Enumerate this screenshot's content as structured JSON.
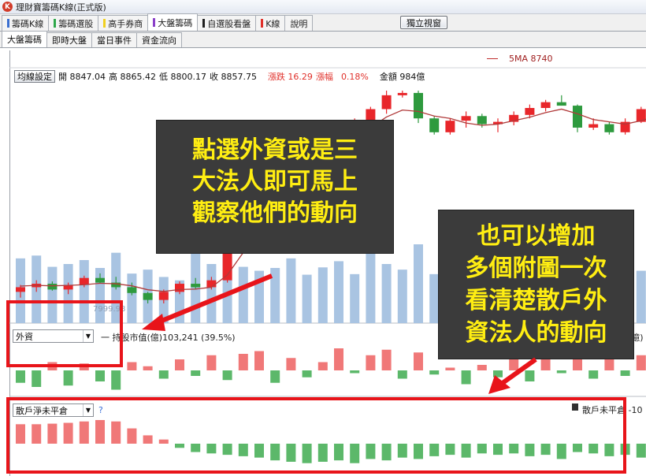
{
  "window": {
    "title": "理財寶籌碼K線(正式版)",
    "icon": "K"
  },
  "main_tabs": [
    {
      "label": "籌碼K線",
      "color": "#3b6fd0"
    },
    {
      "label": "籌碼選股",
      "color": "#2ea84a"
    },
    {
      "label": "高手券商",
      "color": "#f0d020"
    },
    {
      "label": "大盤籌碼",
      "color": "#8a3fc8"
    },
    {
      "label": "自選股看盤",
      "color": "#202020"
    },
    {
      "label": "K線",
      "color": "#e0302a"
    },
    {
      "label": "說明",
      "color": ""
    }
  ],
  "active_main_tab": "大盤籌碼",
  "popout_button": "獨立視窗",
  "sub_tabs": [
    "大盤籌碼",
    "即時大盤",
    "當日事件",
    "資金流向"
  ],
  "active_sub_tab": "大盤籌碼",
  "ma_legend": "5MA 8740",
  "quote": {
    "ma_settings_button": "均線設定",
    "open": "開 8847.04",
    "high": "高 8865.42",
    "low": "低 8800.17",
    "close": "收 8857.75",
    "change": "漲跌 16.29",
    "pct_label": "漲幅",
    "pct": "0.18%",
    "amount": "金額 984億"
  },
  "left_axis_value": "7999.98",
  "panel1": {
    "selected": "外資",
    "text": "一 持股市值(億)103,241 (39.5%)",
    "legend_tail": "(億)"
  },
  "panel2": {
    "selected": "散戶淨未平倉",
    "help": "?",
    "legend": "散戶未平倉 -10"
  },
  "callouts": {
    "left": [
      "點選外資或是三",
      "大法人即可馬上",
      "觀察他們的動向"
    ],
    "right": [
      "也可以增加",
      "多個附圖一次",
      "看清楚散戶外",
      "資法人的動向"
    ]
  },
  "colors": {
    "up": "#e8262a",
    "down": "#2e9a3e",
    "volume": "#a9c4e2",
    "ma": "#b03a3a",
    "bar_up": "#f07878",
    "bar_down": "#5cb86a",
    "highlight": "#e8141a",
    "callout_text": "#ffee12"
  },
  "chart_data": {
    "type": "candlestick",
    "candles": [
      [
        8010,
        8040,
        7985,
        8030
      ],
      [
        8030,
        8060,
        8010,
        8045
      ],
      [
        8045,
        8055,
        8015,
        8020
      ],
      [
        8020,
        8050,
        8000,
        8040
      ],
      [
        8040,
        8080,
        8030,
        8070
      ],
      [
        8070,
        8090,
        8045,
        8050
      ],
      [
        8050,
        8075,
        8020,
        8030
      ],
      [
        8030,
        8050,
        7995,
        8005
      ],
      [
        8005,
        8010,
        7960,
        7975
      ],
      [
        7975,
        8020,
        7960,
        8010
      ],
      [
        8010,
        8055,
        8000,
        8045
      ],
      [
        8045,
        8070,
        8020,
        8030
      ],
      [
        8030,
        8075,
        8020,
        8060
      ],
      [
        8060,
        8250,
        8050,
        8240
      ],
      [
        8240,
        8400,
        8230,
        8390
      ],
      [
        8390,
        8460,
        8380,
        8450
      ],
      [
        8450,
        8560,
        8440,
        8550
      ],
      [
        8550,
        8580,
        8470,
        8480
      ],
      [
        8480,
        8680,
        8470,
        8660
      ],
      [
        8660,
        8700,
        8620,
        8690
      ],
      [
        8690,
        8720,
        8660,
        8700
      ],
      [
        8700,
        8760,
        8690,
        8740
      ],
      [
        8740,
        8810,
        8730,
        8800
      ],
      [
        8800,
        8880,
        8780,
        8860
      ],
      [
        8860,
        8880,
        8850,
        8870
      ],
      [
        8870,
        8880,
        8740,
        8760
      ],
      [
        8760,
        8770,
        8690,
        8700
      ],
      [
        8700,
        8760,
        8690,
        8750
      ],
      [
        8750,
        8790,
        8720,
        8770
      ],
      [
        8770,
        8780,
        8720,
        8735
      ],
      [
        8735,
        8760,
        8700,
        8745
      ],
      [
        8745,
        8790,
        8730,
        8775
      ],
      [
        8775,
        8820,
        8760,
        8805
      ],
      [
        8805,
        8840,
        8790,
        8830
      ],
      [
        8830,
        8860,
        8815,
        8815
      ],
      [
        8815,
        8820,
        8700,
        8720
      ],
      [
        8720,
        8760,
        8710,
        8735
      ],
      [
        8735,
        8745,
        8690,
        8700
      ],
      [
        8700,
        8760,
        8690,
        8745
      ],
      [
        8745,
        8810,
        8740,
        8800
      ],
      [
        8800,
        8860,
        8790,
        8850
      ]
    ],
    "ma5": [
      8035,
      8038,
      8036,
      8038,
      8041,
      8047,
      8045,
      8036,
      8019,
      8012,
      8020,
      8022,
      8030,
      8083,
      8180,
      8270,
      8370,
      8430,
      8505,
      8565,
      8630,
      8668,
      8720,
      8766,
      8796,
      8790,
      8770,
      8760,
      8740,
      8730,
      8735,
      8750,
      8765,
      8785,
      8800,
      8780,
      8755,
      8745,
      8735,
      8750,
      8770
    ],
    "volume": [
      1150,
      1200,
      1000,
      1050,
      1120,
      980,
      1250,
      880,
      950,
      820,
      760,
      1300,
      1050,
      1180,
      1000,
      930,
      980,
      1150,
      860,
      990,
      1100,
      870,
      1350,
      1050,
      950,
      1400,
      870,
      920,
      1000,
      1380,
      1100,
      960,
      1200,
      870,
      1000,
      900,
      1150,
      960,
      1050,
      930,
      1200
    ],
    "foreign_net": [
      -45,
      -60,
      30,
      -55,
      25,
      -40,
      -70,
      30,
      15,
      -30,
      40,
      -20,
      55,
      -35,
      60,
      70,
      -45,
      45,
      -25,
      30,
      80,
      -10,
      55,
      75,
      -30,
      65,
      -15,
      10,
      -50,
      20,
      -25,
      60,
      -40,
      45,
      -10,
      50,
      -30,
      40,
      -20,
      55,
      -35
    ],
    "retail_net": [
      70,
      70,
      72,
      75,
      80,
      85,
      80,
      55,
      30,
      15,
      -15,
      -30,
      -35,
      -40,
      -45,
      -50,
      -60,
      -65,
      -70,
      -65,
      -60,
      -70,
      -55,
      -60,
      -50,
      -55,
      -45,
      -40,
      -50,
      -35,
      -40,
      -35,
      -45,
      -40,
      -55,
      -30,
      -35,
      -45,
      -40,
      -50,
      -35
    ],
    "ylim": [
      7960,
      8880
    ]
  }
}
